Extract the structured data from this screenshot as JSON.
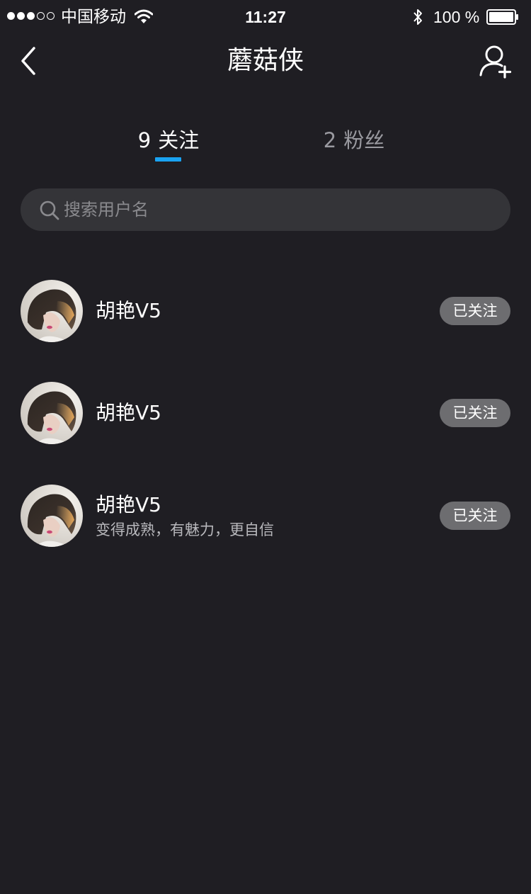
{
  "status_bar": {
    "carrier": "中国移动",
    "time": "11:27",
    "battery": "100 %"
  },
  "nav": {
    "title": "蘑菇侠",
    "back_icon": "chevron-left-icon",
    "add_user_icon": "add-user-icon"
  },
  "tabs": [
    {
      "count": "9",
      "label": "关注",
      "active": true
    },
    {
      "count": "2",
      "label": "粉丝",
      "active": false
    }
  ],
  "search": {
    "placeholder": "搜索用户名"
  },
  "users": [
    {
      "name": "胡艳V5",
      "bio": "",
      "button": "已关注"
    },
    {
      "name": "胡艳V5",
      "bio": "",
      "button": "已关注"
    },
    {
      "name": "胡艳V5",
      "bio": "变得成熟，有魅力，更自信",
      "button": "已关注"
    }
  ],
  "colors": {
    "background": "#1f1e23",
    "accent": "#1aa3f2",
    "search_bg": "#343438",
    "button_bg": "#6d6d70"
  }
}
